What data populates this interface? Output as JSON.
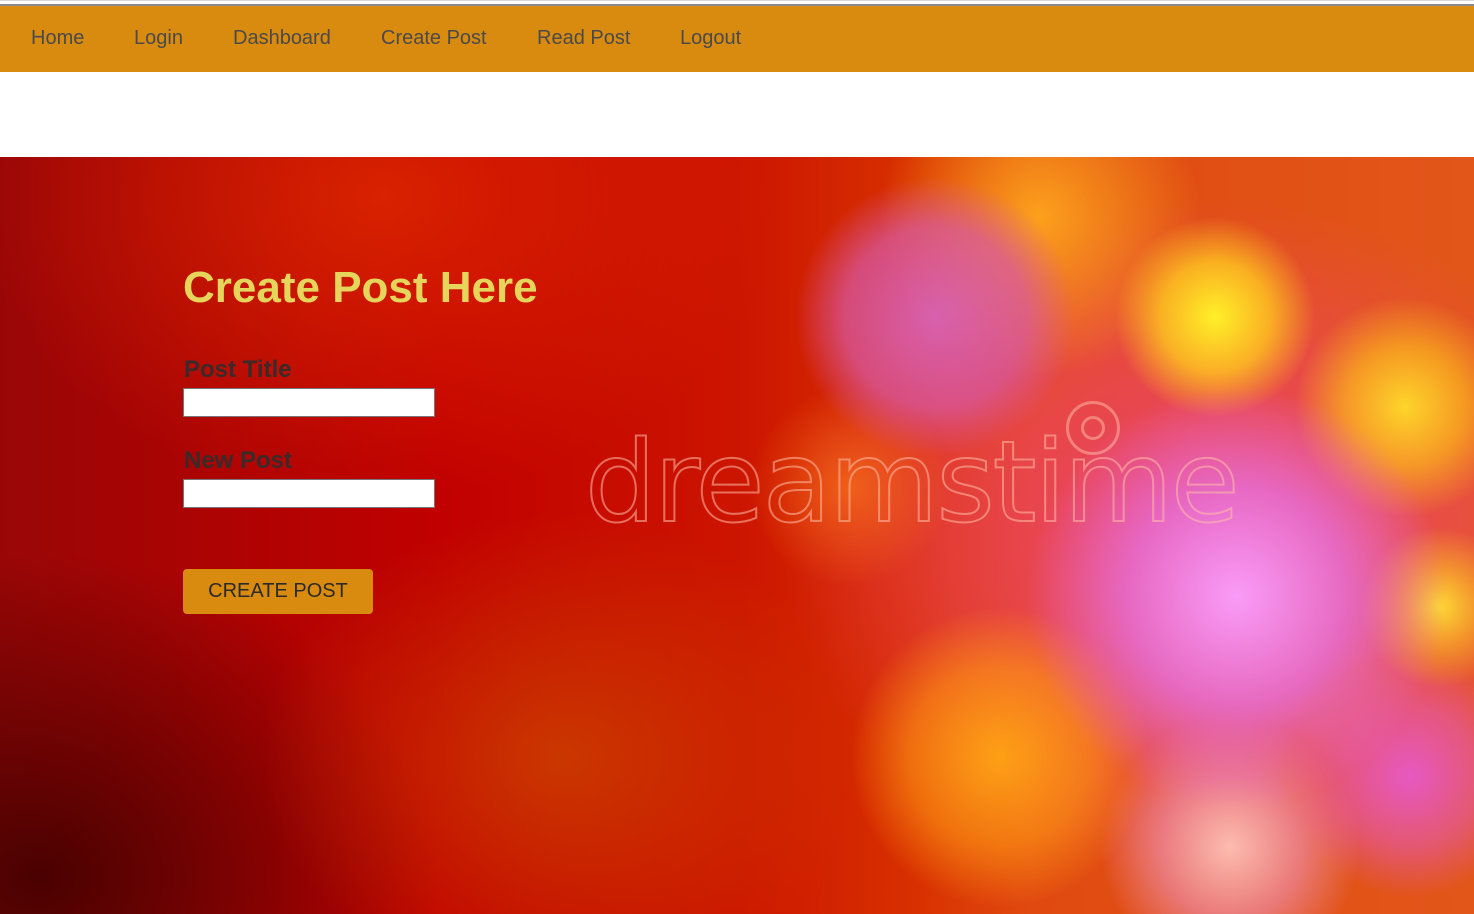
{
  "nav": {
    "items": [
      {
        "label": "Home"
      },
      {
        "label": "Login"
      },
      {
        "label": "Dashboard"
      },
      {
        "label": "Create Post"
      },
      {
        "label": "Read Post"
      },
      {
        "label": "Logout"
      }
    ]
  },
  "hero": {
    "watermark": "dreamstime"
  },
  "form": {
    "title": "Create Post Here",
    "post_title_label": "Post Title",
    "post_title_value": "",
    "new_post_label": "New Post",
    "new_post_value": "",
    "submit_label": "CREATE POST"
  },
  "colors": {
    "navbar": "#d98b10",
    "title": "#e5d55a",
    "button": "#d98b10"
  }
}
